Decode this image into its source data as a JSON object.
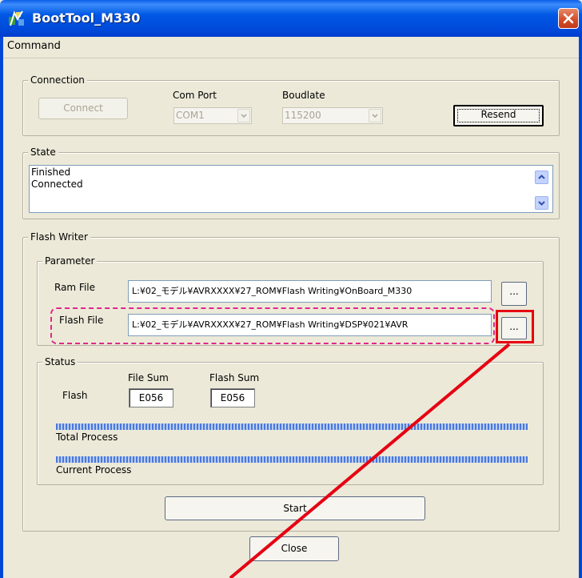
{
  "window": {
    "title": "BootTool_M330"
  },
  "menu": {
    "command": "Command"
  },
  "connection": {
    "group_label": "Connection",
    "connect_label": "Connect",
    "com_port_label": "Com Port",
    "com_port_value": "COM1",
    "boudlate_label": "Boudlate",
    "boudlate_value": "115200",
    "resend_label": "Resend"
  },
  "state": {
    "group_label": "State",
    "lines": [
      "Finished",
      "Connected"
    ]
  },
  "flash_writer": {
    "group_label": "Flash Writer",
    "parameter": {
      "group_label": "Parameter",
      "ram_file_label": "Ram File",
      "ram_file_value": "L:¥02_モデル¥AVRXXXX¥27_ROM¥Flash Writing¥OnBoard_M330",
      "flash_file_label": "Flash File",
      "flash_file_value": "L:¥02_モデル¥AVRXXXX¥27_ROM¥Flash Writing¥DSP¥021¥AVR",
      "browse_label": "..."
    },
    "status": {
      "group_label": "Status",
      "file_sum_label": "File Sum",
      "flash_sum_label": "Flash Sum",
      "flash_label": "Flash",
      "file_sum_value": "E056",
      "flash_sum_value": "E056",
      "total_process_label": "Total Process",
      "current_process_label": "Current Process",
      "total_progress": 1.0,
      "current_progress": 1.0
    },
    "start_label": "Start"
  },
  "footer": {
    "close_label": "Close"
  },
  "annotation": {
    "dashed_color": "#e0288a",
    "highlight_color": "#e60012"
  }
}
